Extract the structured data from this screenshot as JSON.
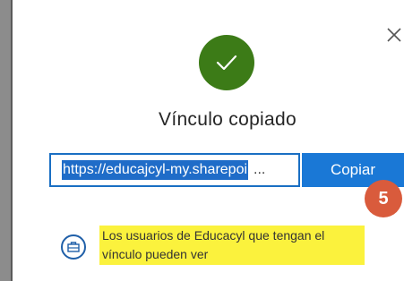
{
  "dialog": {
    "title": "Vínculo copiado",
    "link_url": "https://educajcyl-my.sharepoi",
    "link_ellipsis": "...",
    "copy_label": "Copiar",
    "step_number": "5",
    "permission_line1": "Los usuarios de Educacyl que tengan el",
    "permission_line2": "vínculo pueden ver",
    "icons": {
      "close": "close-icon",
      "success": "checkmark-icon",
      "permission": "organization-icon"
    },
    "colors": {
      "success_green": "#3c7b17",
      "accent_blue": "#1a78d6",
      "step_badge": "#d95b3c",
      "highlight_yellow": "#fbf23d"
    }
  }
}
